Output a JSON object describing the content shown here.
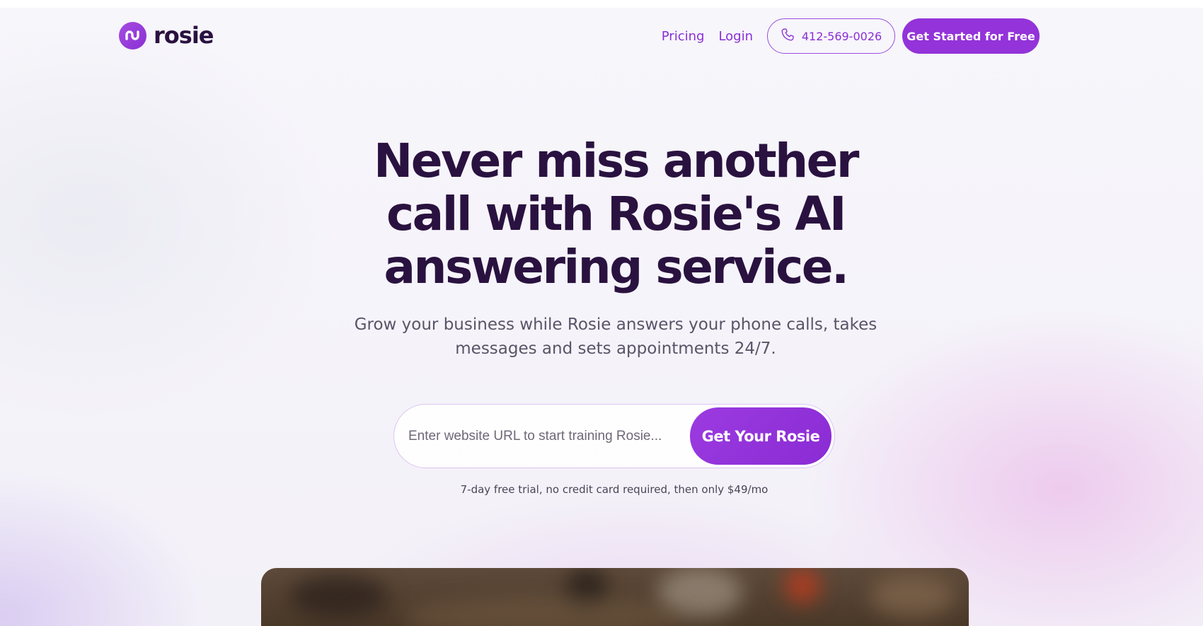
{
  "brand": {
    "name": "rosie",
    "accent_color": "#9333d9",
    "text_color": "#2a1240"
  },
  "nav": {
    "links": [
      "Pricing",
      "Login"
    ],
    "phone": "412-569-0026",
    "phone_icon": "phone-icon",
    "cta": "Get Started for Free"
  },
  "hero": {
    "title_lines": [
      "Never miss another",
      "call with Rosie's AI",
      "answering service."
    ],
    "subtitle_lines": [
      "Grow your business while Rosie answers your phone calls, takes",
      "messages and sets appointments 24/7."
    ],
    "input_placeholder": "Enter website URL to start training Rosie...",
    "submit_label": "Get Your Rosie",
    "trial_note": "7-day free trial, no credit card required, then only $49/mo"
  }
}
